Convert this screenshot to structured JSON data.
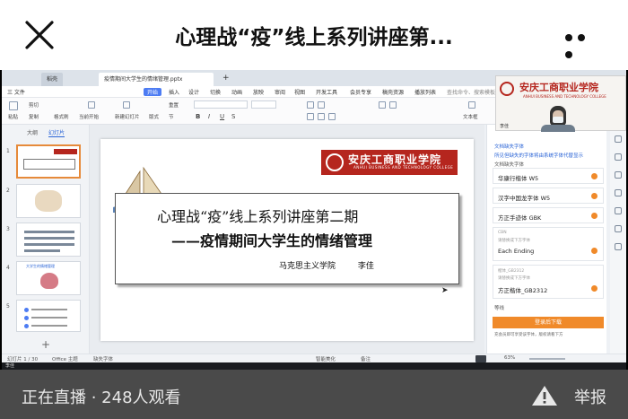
{
  "header": {
    "title": "心理战“疫”线上系列讲座第..."
  },
  "wps": {
    "tabs": [
      "稻壳",
      "疫情期间大学生的情绪管理.pptx"
    ],
    "menu": [
      "三 文件",
      "开始",
      "插入",
      "设计",
      "切换",
      "动画",
      "放映",
      "审阅",
      "视图",
      "开发工具",
      "会员专享",
      "稿壳资源",
      "播放列表",
      "查找命令、搜索模板"
    ],
    "toolbar": [
      "粘贴",
      "剪切",
      "复制",
      "格式刷",
      "当前开始",
      "新建幻灯片",
      "版式",
      "节",
      "重置",
      "文本框"
    ],
    "pane_tabs": [
      "大纲",
      "幻灯片"
    ],
    "thumb_numbers": [
      "1",
      "2",
      "3",
      "4",
      "5"
    ],
    "thumb3_text": "",
    "thumb4_text": "大学生的情绪管理",
    "status": {
      "slide": "幻灯片 1 / 30",
      "theme": "Office 主题",
      "font": "缺失字体",
      "notes": "备注",
      "smart": "智能美化",
      "zoom": "63%"
    },
    "taskbar_label": "李佳"
  },
  "slide": {
    "college_cn": "安庆工商职业学院",
    "college_en": "ANHUI BUSINESS AND TECHNOLOGY COLLEGE",
    "line1": "心理战“疫”线上系列讲座第二期",
    "line2": "——疫情期间大学生的情绪管理",
    "author": "马克思主义学院 李佳"
  },
  "right_panel": {
    "heading": "文档缺失字体",
    "subheading": "所见但缺失的字体将由系统字体代替显示",
    "label": "文档缺失字体",
    "fonts": [
      {
        "name": "华康行楷体 W5",
        "note": ""
      },
      {
        "name": "汉字中国龙字体 W5",
        "note": ""
      },
      {
        "name": "方正手迹体 GBK",
        "note": ""
      },
      {
        "name": "Each Ending",
        "note": "CBN",
        "sub": "请替换成下方字体"
      },
      {
        "name": "方正楷体_GB2312",
        "note": "楷体_GB2312",
        "sub": "请替换成下方字体"
      }
    ],
    "more": "等线",
    "login_btn": "登录后下载",
    "note": "充会员即可享受该字体，版权请看下方"
  },
  "webcam": {
    "college_cn": "安庆工商职业学院",
    "college_en": "ANHUI BUSINESS AND TECHNOLOGY COLLEGE",
    "name": "李佳"
  },
  "footer": {
    "live_status": "正在直播 · 248人观看",
    "report": "举报"
  }
}
